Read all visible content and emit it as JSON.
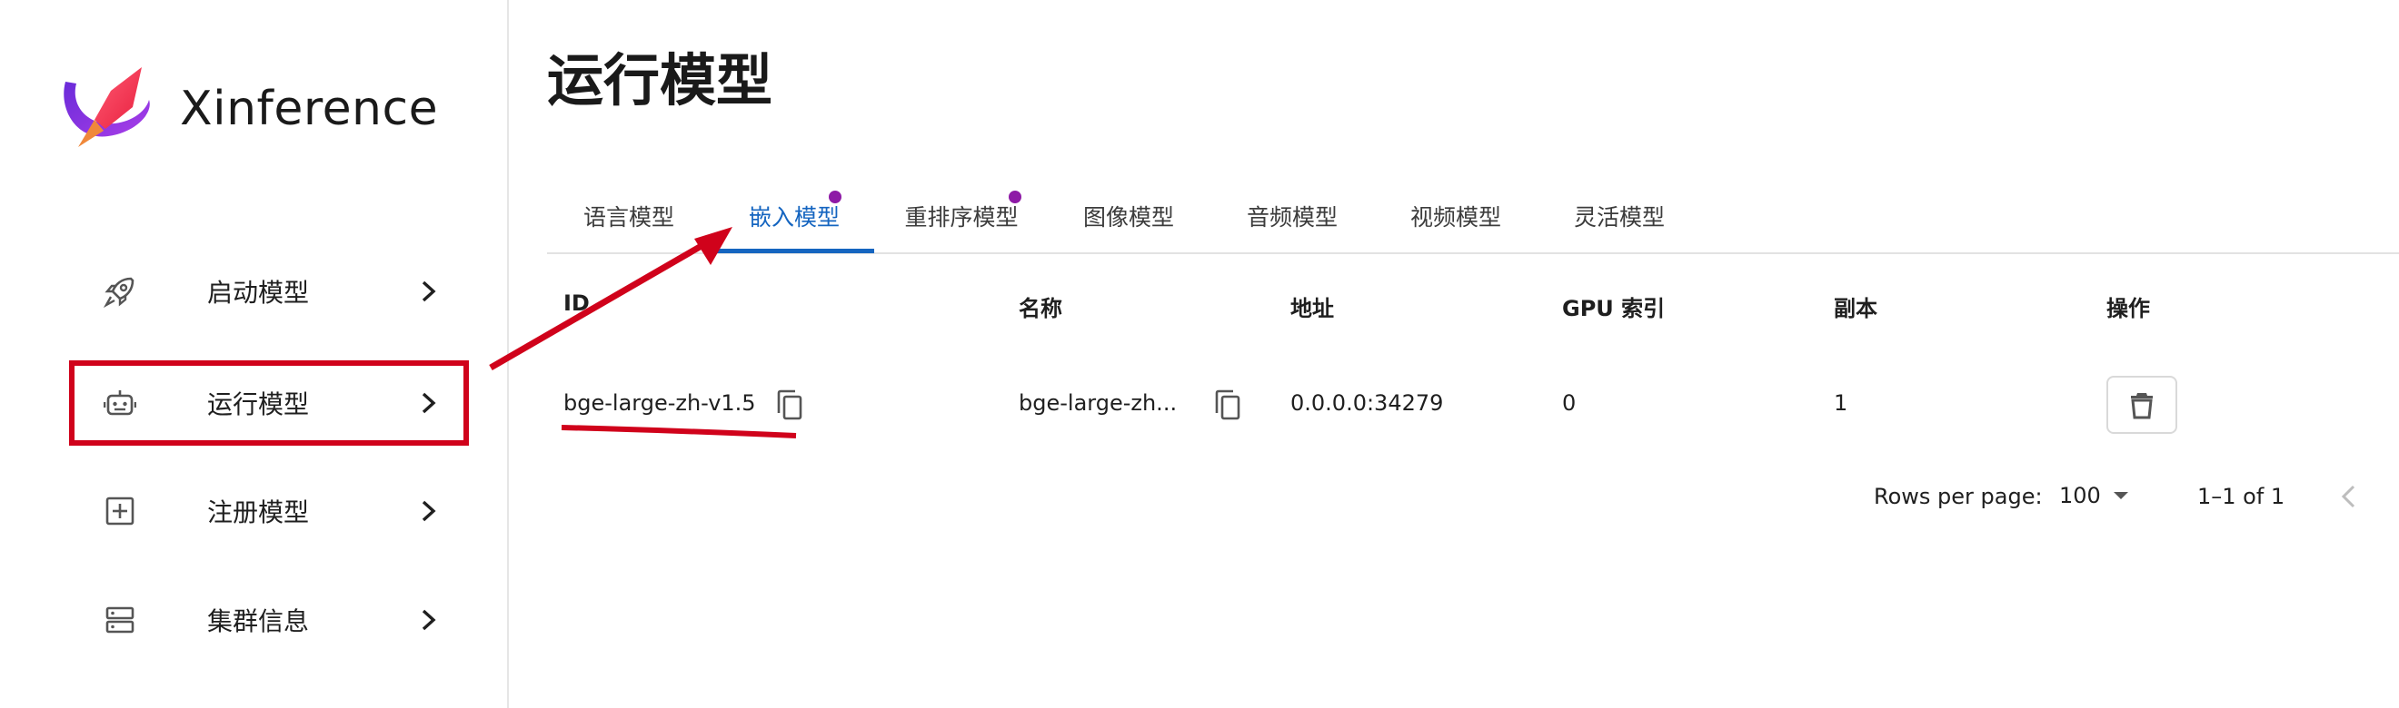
{
  "app": {
    "brand": "Xinference"
  },
  "sidebar": {
    "items": [
      {
        "label": "启动模型",
        "icon": "rocket-icon"
      },
      {
        "label": "运行模型",
        "icon": "robot-icon"
      },
      {
        "label": "注册模型",
        "icon": "add-box-icon"
      },
      {
        "label": "集群信息",
        "icon": "server-icon"
      }
    ]
  },
  "page": {
    "title": "运行模型"
  },
  "tabs": [
    {
      "label": "语言模型",
      "active": false,
      "badge": false
    },
    {
      "label": "嵌入模型",
      "active": true,
      "badge": true
    },
    {
      "label": "重排序模型",
      "active": false,
      "badge": true
    },
    {
      "label": "图像模型",
      "active": false,
      "badge": false
    },
    {
      "label": "音频模型",
      "active": false,
      "badge": false
    },
    {
      "label": "视频模型",
      "active": false,
      "badge": false
    },
    {
      "label": "灵活模型",
      "active": false,
      "badge": false
    }
  ],
  "table": {
    "columns": [
      "ID",
      "名称",
      "地址",
      "GPU 索引",
      "副本",
      "操作"
    ],
    "rows": [
      {
        "id": "bge-large-zh-v1.5",
        "name": "bge-large-zh...",
        "address": "0.0.0.0:34279",
        "gpu_index": "0",
        "replica": "1"
      }
    ]
  },
  "pagination": {
    "rows_per_page_label": "Rows per page:",
    "rows_per_page": "100",
    "range": "1–1 of 1"
  },
  "colors": {
    "accent_blue": "#1565c0",
    "badge_purple": "#8e1aa6",
    "annotation_red": "#d0021b"
  }
}
